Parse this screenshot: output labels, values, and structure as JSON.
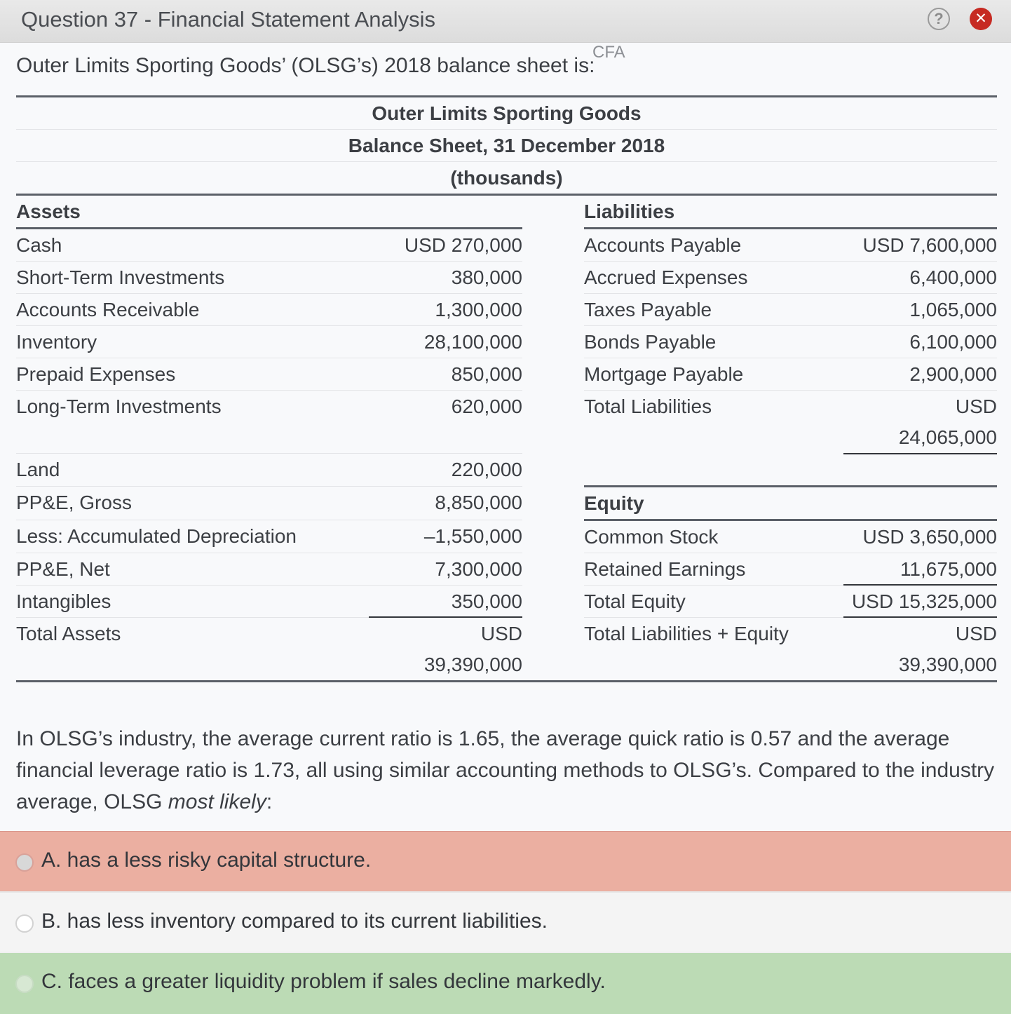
{
  "window": {
    "title": "Question 37 - Financial Statement Analysis",
    "help": "?",
    "close": "✕"
  },
  "intro": "Outer Limits Sporting Goods’ (OLSG’s) 2018 balance sheet is:",
  "watermark": "CFA",
  "sheet": {
    "title1": "Outer Limits Sporting Goods",
    "title2": "Balance Sheet, 31 December 2018",
    "title3": "(thousands)",
    "assets_header": "Assets",
    "liabilities_header": "Liabilities",
    "equity_header": "Equity",
    "assets": [
      {
        "label": "Cash",
        "value": "USD 270,000"
      },
      {
        "label": "Short-Term Investments",
        "value": "380,000"
      },
      {
        "label": "Accounts Receivable",
        "value": "1,300,000"
      },
      {
        "label": "Inventory",
        "value": "28,100,000"
      },
      {
        "label": "Prepaid Expenses",
        "value": "850,000"
      },
      {
        "label": "Long-Term Investments",
        "value": "620,000"
      },
      {
        "label": "Land",
        "value": "220,000"
      },
      {
        "label": "PP&E, Gross",
        "value": "8,850,000"
      },
      {
        "label": "Less: Accumulated Depreciation",
        "value": "–1,550,000"
      },
      {
        "label": "PP&E, Net",
        "value": "7,300,000"
      },
      {
        "label": "Intangibles",
        "value": "350,000"
      }
    ],
    "total_assets": {
      "label": "Total Assets",
      "value_line1": "USD",
      "value_line2": "39,390,000"
    },
    "liabilities": [
      {
        "label": "Accounts Payable",
        "value": "USD 7,600,000"
      },
      {
        "label": "Accrued Expenses",
        "value": "6,400,000"
      },
      {
        "label": "Taxes Payable",
        "value": "1,065,000"
      },
      {
        "label": "Bonds Payable",
        "value": "6,100,000"
      },
      {
        "label": "Mortgage Payable",
        "value": "2,900,000"
      }
    ],
    "total_liabilities": {
      "label": "Total Liabilities",
      "value_line1": "USD",
      "value_line2": "24,065,000"
    },
    "equity": [
      {
        "label": "Common Stock",
        "value": "USD 3,650,000"
      },
      {
        "label": "Retained Earnings",
        "value": "11,675,000"
      }
    ],
    "total_equity": {
      "label": "Total Equity",
      "value": "USD 15,325,000"
    },
    "total_liab_equity": {
      "label": "Total Liabilities + Equity",
      "value_line1": "USD",
      "value_line2": "39,390,000"
    }
  },
  "question": {
    "text1": "In OLSG’s industry, the average current ratio is 1.65, the average quick ratio is 0.57 and the average financial leverage ratio is 1.73, all using similar accounting methods to OLSG’s.  Compared to the industry average, OLSG ",
    "emphasis": "most likely",
    "text2": ":"
  },
  "options": [
    {
      "label": "A. has a less risky capital structure.",
      "state": "incorrect-selected"
    },
    {
      "label": "B. has less inventory compared to its current liabilities.",
      "state": "neutral"
    },
    {
      "label": "C. faces a greater liquidity problem if sales decline markedly.",
      "state": "correct"
    }
  ],
  "colors": {
    "accent_orange": "#cc6428",
    "incorrect": "#ebafa1",
    "correct": "#bcdbb5",
    "close": "#c62a22"
  }
}
